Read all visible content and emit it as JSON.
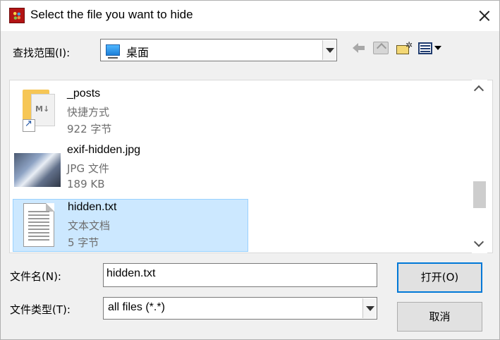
{
  "titlebar": {
    "title": "Select the file you want to hide",
    "app_icon": "app-icon",
    "close_icon": "close-icon"
  },
  "lookin": {
    "label": "查找范围(I):",
    "value": "桌面",
    "icon": "desktop-icon"
  },
  "toolbar": {
    "icons": [
      "back-icon",
      "up-folder-icon",
      "new-folder-icon",
      "view-menu-icon"
    ]
  },
  "files": [
    {
      "name": "_posts",
      "type": "快捷方式",
      "size": "922 字节",
      "icon": "markdown-folder-shortcut-icon",
      "selected": false
    },
    {
      "name": "exif-hidden.jpg",
      "type": "JPG 文件",
      "size": "189 KB",
      "icon": "image-thumbnail-icon",
      "selected": false
    },
    {
      "name": "hidden.txt",
      "type": "文本文档",
      "size": "5 字节",
      "icon": "text-file-icon",
      "selected": true
    }
  ],
  "filename": {
    "label": "文件名(N):",
    "value": "hidden.txt"
  },
  "filetype": {
    "label": "文件类型(T):",
    "value": "all files (*.*)"
  },
  "buttons": {
    "open": "打开(O)",
    "cancel": "取消"
  },
  "colors": {
    "selection_bg": "#cce8ff",
    "selection_border": "#99d1ff",
    "default_button_border": "#0078d7"
  }
}
